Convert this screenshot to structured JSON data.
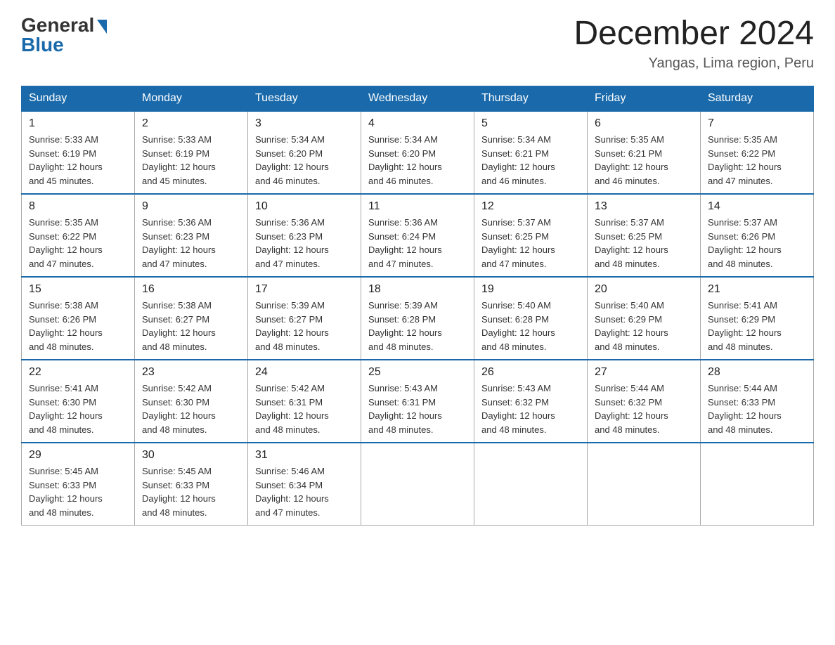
{
  "logo": {
    "general": "General",
    "blue": "Blue"
  },
  "header": {
    "month_year": "December 2024",
    "location": "Yangas, Lima region, Peru"
  },
  "weekdays": [
    "Sunday",
    "Monday",
    "Tuesday",
    "Wednesday",
    "Thursday",
    "Friday",
    "Saturday"
  ],
  "weeks": [
    [
      {
        "day": "1",
        "sunrise": "5:33 AM",
        "sunset": "6:19 PM",
        "daylight": "12 hours and 45 minutes."
      },
      {
        "day": "2",
        "sunrise": "5:33 AM",
        "sunset": "6:19 PM",
        "daylight": "12 hours and 45 minutes."
      },
      {
        "day": "3",
        "sunrise": "5:34 AM",
        "sunset": "6:20 PM",
        "daylight": "12 hours and 46 minutes."
      },
      {
        "day": "4",
        "sunrise": "5:34 AM",
        "sunset": "6:20 PM",
        "daylight": "12 hours and 46 minutes."
      },
      {
        "day": "5",
        "sunrise": "5:34 AM",
        "sunset": "6:21 PM",
        "daylight": "12 hours and 46 minutes."
      },
      {
        "day": "6",
        "sunrise": "5:35 AM",
        "sunset": "6:21 PM",
        "daylight": "12 hours and 46 minutes."
      },
      {
        "day": "7",
        "sunrise": "5:35 AM",
        "sunset": "6:22 PM",
        "daylight": "12 hours and 47 minutes."
      }
    ],
    [
      {
        "day": "8",
        "sunrise": "5:35 AM",
        "sunset": "6:22 PM",
        "daylight": "12 hours and 47 minutes."
      },
      {
        "day": "9",
        "sunrise": "5:36 AM",
        "sunset": "6:23 PM",
        "daylight": "12 hours and 47 minutes."
      },
      {
        "day": "10",
        "sunrise": "5:36 AM",
        "sunset": "6:23 PM",
        "daylight": "12 hours and 47 minutes."
      },
      {
        "day": "11",
        "sunrise": "5:36 AM",
        "sunset": "6:24 PM",
        "daylight": "12 hours and 47 minutes."
      },
      {
        "day": "12",
        "sunrise": "5:37 AM",
        "sunset": "6:25 PM",
        "daylight": "12 hours and 47 minutes."
      },
      {
        "day": "13",
        "sunrise": "5:37 AM",
        "sunset": "6:25 PM",
        "daylight": "12 hours and 48 minutes."
      },
      {
        "day": "14",
        "sunrise": "5:37 AM",
        "sunset": "6:26 PM",
        "daylight": "12 hours and 48 minutes."
      }
    ],
    [
      {
        "day": "15",
        "sunrise": "5:38 AM",
        "sunset": "6:26 PM",
        "daylight": "12 hours and 48 minutes."
      },
      {
        "day": "16",
        "sunrise": "5:38 AM",
        "sunset": "6:27 PM",
        "daylight": "12 hours and 48 minutes."
      },
      {
        "day": "17",
        "sunrise": "5:39 AM",
        "sunset": "6:27 PM",
        "daylight": "12 hours and 48 minutes."
      },
      {
        "day": "18",
        "sunrise": "5:39 AM",
        "sunset": "6:28 PM",
        "daylight": "12 hours and 48 minutes."
      },
      {
        "day": "19",
        "sunrise": "5:40 AM",
        "sunset": "6:28 PM",
        "daylight": "12 hours and 48 minutes."
      },
      {
        "day": "20",
        "sunrise": "5:40 AM",
        "sunset": "6:29 PM",
        "daylight": "12 hours and 48 minutes."
      },
      {
        "day": "21",
        "sunrise": "5:41 AM",
        "sunset": "6:29 PM",
        "daylight": "12 hours and 48 minutes."
      }
    ],
    [
      {
        "day": "22",
        "sunrise": "5:41 AM",
        "sunset": "6:30 PM",
        "daylight": "12 hours and 48 minutes."
      },
      {
        "day": "23",
        "sunrise": "5:42 AM",
        "sunset": "6:30 PM",
        "daylight": "12 hours and 48 minutes."
      },
      {
        "day": "24",
        "sunrise": "5:42 AM",
        "sunset": "6:31 PM",
        "daylight": "12 hours and 48 minutes."
      },
      {
        "day": "25",
        "sunrise": "5:43 AM",
        "sunset": "6:31 PM",
        "daylight": "12 hours and 48 minutes."
      },
      {
        "day": "26",
        "sunrise": "5:43 AM",
        "sunset": "6:32 PM",
        "daylight": "12 hours and 48 minutes."
      },
      {
        "day": "27",
        "sunrise": "5:44 AM",
        "sunset": "6:32 PM",
        "daylight": "12 hours and 48 minutes."
      },
      {
        "day": "28",
        "sunrise": "5:44 AM",
        "sunset": "6:33 PM",
        "daylight": "12 hours and 48 minutes."
      }
    ],
    [
      {
        "day": "29",
        "sunrise": "5:45 AM",
        "sunset": "6:33 PM",
        "daylight": "12 hours and 48 minutes."
      },
      {
        "day": "30",
        "sunrise": "5:45 AM",
        "sunset": "6:33 PM",
        "daylight": "12 hours and 48 minutes."
      },
      {
        "day": "31",
        "sunrise": "5:46 AM",
        "sunset": "6:34 PM",
        "daylight": "12 hours and 47 minutes."
      },
      null,
      null,
      null,
      null
    ]
  ],
  "labels": {
    "sunrise": "Sunrise:",
    "sunset": "Sunset:",
    "daylight": "Daylight:"
  }
}
